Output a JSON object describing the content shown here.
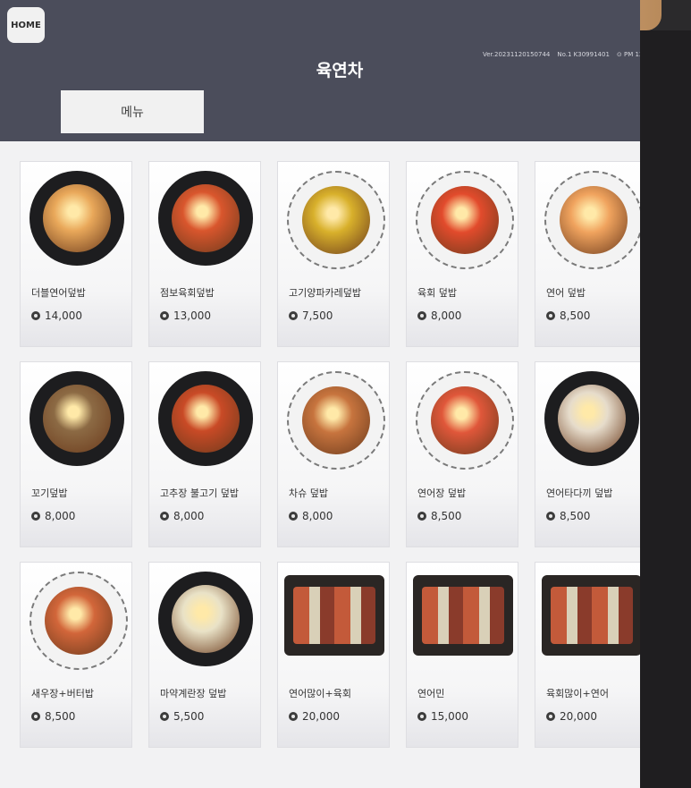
{
  "header": {
    "home_label": "HOME",
    "title": "육연차",
    "version": "Ver.20231120150744",
    "number": "No.1 K30991401",
    "time": "PM 12:46"
  },
  "tabs": {
    "menu_label": "메뉴"
  },
  "items": [
    {
      "name": "더블연어덮밥",
      "price": "14,000",
      "color": "#e9a85a"
    },
    {
      "name": "점보육회덮밥",
      "price": "13,000",
      "color": "#d9562d"
    },
    {
      "name": "고기양파카레덮밥",
      "price": "7,500",
      "color": "#d8b02b"
    },
    {
      "name": "육회 덮밥",
      "price": "8,000",
      "color": "#e24b2c"
    },
    {
      "name": "연어 덮밥",
      "price": "8,500",
      "color": "#f0a35e"
    },
    {
      "name": "꼬기덮밥",
      "price": "8,000",
      "color": "#8c6a44"
    },
    {
      "name": "고추장 불고기 덮밥",
      "price": "8,000",
      "color": "#c94a26"
    },
    {
      "name": "차슈 덮밥",
      "price": "8,000",
      "color": "#c7743e"
    },
    {
      "name": "연어장 덮밥",
      "price": "8,500",
      "color": "#e0573a"
    },
    {
      "name": "연어타다끼 덮밥",
      "price": "8,500",
      "color": "#e6dccb"
    },
    {
      "name": "새우장+버터밥",
      "price": "8,500",
      "color": "#d2663a"
    },
    {
      "name": "마약계란장 덮밥",
      "price": "5,500",
      "color": "#e9e2c7"
    },
    {
      "name": "연어많이+육회",
      "price": "20,000",
      "color": "#e27c3d"
    },
    {
      "name": "연어민",
      "price": "15,000",
      "color": "#e69a58"
    },
    {
      "name": "육회많이+연어",
      "price": "20,000",
      "color": "#d65a36"
    }
  ]
}
